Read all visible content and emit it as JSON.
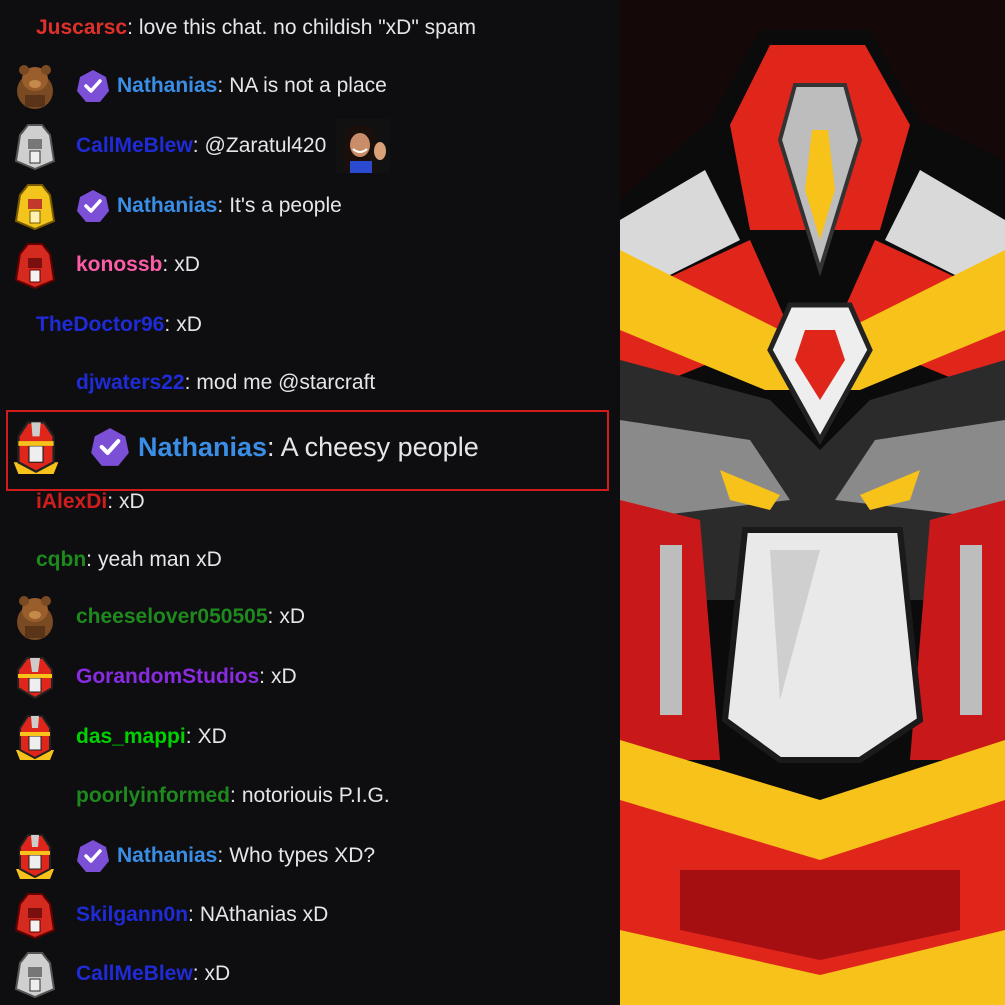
{
  "chat": {
    "messages": [
      {
        "user": "Juscarsc",
        "color": "#e0302a",
        "text": "love this chat. no childish \"xD\" spam",
        "avatar": "none",
        "badge": false
      },
      {
        "user": "Nathanias",
        "color": "#3a8ee6",
        "text": "NA is not a place",
        "avatar": "brown-bear-avatar",
        "badge": true
      },
      {
        "user": "CallMeBlew",
        "color": "#1f2bd6",
        "text": "@Zaratul420",
        "avatar": "silver-robot-avatar",
        "badge": false,
        "emote": "waving-woman-emote"
      },
      {
        "user": "Nathanias",
        "color": "#3a8ee6",
        "text": "It's a people",
        "avatar": "gold-robot-avatar",
        "badge": true
      },
      {
        "user": "konossb",
        "color": "#ff5ca8",
        "text": "xD",
        "avatar": "red-robot-avatar",
        "badge": false
      },
      {
        "user": "TheDoctor96",
        "color": "#1f2bd6",
        "text": "xD",
        "avatar": "none",
        "badge": false
      },
      {
        "user": "djwaters22",
        "color": "#1f2bd6",
        "text": "mod me @starcraft",
        "avatar": "none",
        "badge": false
      },
      {
        "user": "Nathanias",
        "color": "#3a8ee6",
        "text": "A cheesy people",
        "avatar": "gold-helmet-avatar",
        "badge": true,
        "highlighted": true
      },
      {
        "user": "iAlexDi",
        "color": "#cf1d1d",
        "text": "xD",
        "avatar": "none",
        "badge": false
      },
      {
        "user": "cqbn",
        "color": "#1e8a1e",
        "text": "yeah man xD",
        "avatar": "none",
        "badge": false
      },
      {
        "user": "cheeselover050505",
        "color": "#1e8a1e",
        "text": "xD",
        "avatar": "brown-bear-avatar",
        "badge": false
      },
      {
        "user": "GorandomStudios",
        "color": "#8a2be2",
        "text": "xD",
        "avatar": "red-helmet-avatar",
        "badge": false
      },
      {
        "user": "das_mappi",
        "color": "#00d100",
        "text": "XD",
        "avatar": "gold-helmet-avatar",
        "badge": false
      },
      {
        "user": "poorlyinformed",
        "color": "#1e8a1e",
        "text": "notoriouis P.I.G.",
        "avatar": "none",
        "badge": false
      },
      {
        "user": "Nathanias",
        "color": "#3a8ee6",
        "text": "Who types XD?",
        "avatar": "gold-helmet-avatar",
        "badge": true
      },
      {
        "user": "Skilgann0n",
        "color": "#1f2bd6",
        "text": "NAthanias xD",
        "avatar": "red-robot-avatar",
        "badge": false
      },
      {
        "user": "CallMeBlew",
        "color": "#1f2bd6",
        "text": "xD",
        "avatar": "silver-robot-avatar",
        "badge": false
      }
    ],
    "separator": ":"
  },
  "badge_icon": "verified-check-icon",
  "badge_color": "#7b4fd6",
  "logo": {
    "icon": "red-mecha-helmet-logo",
    "colors": [
      "#e0251b",
      "#f7c21a",
      "#b8b8b8",
      "#1a1a1a"
    ]
  }
}
